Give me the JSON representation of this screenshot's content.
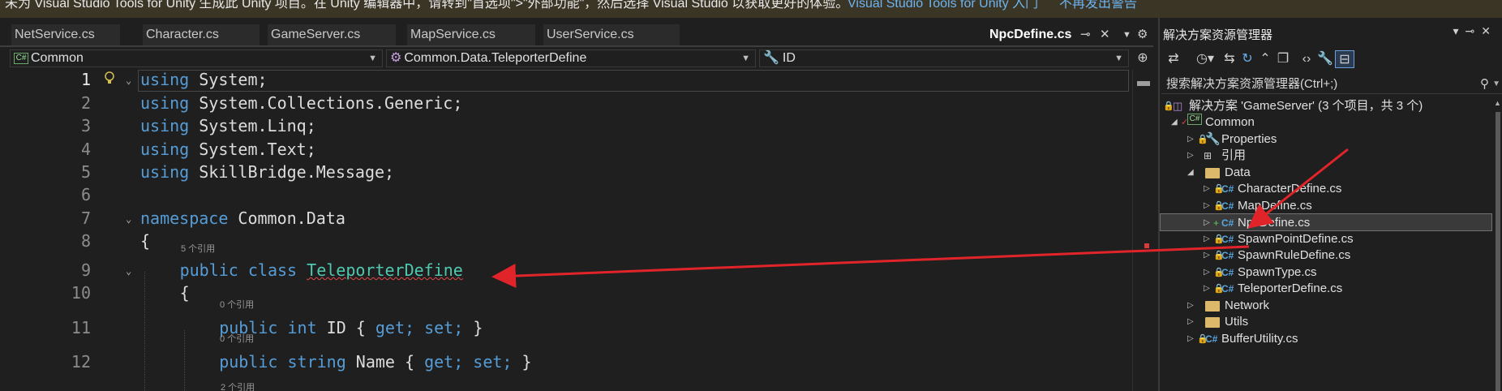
{
  "infobar": {
    "message": "未为 Visual Studio Tools for Unity 生成此 Unity 项目。在 Unity 编辑器中，请转到\"首选项\">\"外部功能\"，然后选择 Visual Studio 以获取更好的体验。",
    "link_tools": "Visual Studio Tools for Unity 入门",
    "link_dismiss": "不再发出警告"
  },
  "tabs": [
    "NetService.cs",
    "Character.cs",
    "GameServer.cs",
    "MapService.cs",
    "UserService.cs"
  ],
  "active_tab": "NpcDefine.cs",
  "tab_icons": {
    "pin": "pin-icon",
    "close": "close-icon",
    "menu": "chevron-down-icon",
    "settings": "gear-icon"
  },
  "navbar": {
    "project": "Common",
    "type": "Common.Data.TeleporterDefine",
    "member": "ID"
  },
  "editor": {
    "lines": [
      {
        "n": "1",
        "ref": "",
        "tokens": [
          [
            "kw",
            "using"
          ],
          [
            "",
            "System;"
          ]
        ]
      },
      {
        "n": "2",
        "ref": "",
        "tokens": [
          [
            "kw",
            "using"
          ],
          [
            "",
            "System.Collections.Generic;"
          ]
        ]
      },
      {
        "n": "3",
        "ref": "",
        "tokens": [
          [
            "kw",
            "using"
          ],
          [
            "",
            "System.Linq;"
          ]
        ]
      },
      {
        "n": "4",
        "ref": "",
        "tokens": [
          [
            "kw",
            "using"
          ],
          [
            "",
            "System.Text;"
          ]
        ]
      },
      {
        "n": "5",
        "ref": "",
        "tokens": [
          [
            "kw",
            "using"
          ],
          [
            "",
            "SkillBridge.Message;"
          ]
        ]
      },
      {
        "n": "6",
        "ref": "",
        "tokens": []
      },
      {
        "n": "7",
        "ref": "",
        "tokens": [
          [
            "kw",
            "namespace"
          ],
          [
            "",
            "Common.Data"
          ]
        ]
      },
      {
        "n": "8",
        "ref": "",
        "tokens": [
          [
            "",
            "{"
          ]
        ]
      },
      {
        "n": "9",
        "ref": "5 个引用",
        "tokens": [
          [
            "kw",
            "public"
          ],
          [
            "kw",
            "class"
          ],
          [
            "ty squig",
            "TeleporterDefine"
          ]
        ]
      },
      {
        "n": "10",
        "ref": "",
        "tokens": [
          [
            "",
            "{"
          ]
        ]
      },
      {
        "n": "11",
        "ref": "0 个引用",
        "tokens": [
          [
            "kw",
            "public"
          ],
          [
            "kw",
            "int"
          ],
          [
            "",
            "ID {"
          ],
          [
            "kw",
            "get;"
          ],
          [
            "kw",
            "set;"
          ],
          [
            "",
            "}"
          ]
        ]
      },
      {
        "n": "12",
        "ref": "0 个引用",
        "tokens": [
          [
            "kw",
            "public"
          ],
          [
            "kw",
            "string"
          ],
          [
            "",
            "Name {"
          ],
          [
            "kw",
            "get;"
          ],
          [
            "kw",
            "set;"
          ],
          [
            "",
            "}"
          ]
        ]
      }
    ],
    "trailing_ref": "2 个引用"
  },
  "solution_explorer": {
    "title": "解决方案资源管理器",
    "search_placeholder": "搜索解决方案资源管理器(Ctrl+;)",
    "solution_label": "解决方案 'GameServer' (3 个项目，共 3 个)",
    "nodes": [
      {
        "label": "Common",
        "kind": "project"
      },
      {
        "label": "Properties",
        "kind": "properties"
      },
      {
        "label": "引用",
        "kind": "references"
      },
      {
        "label": "Data",
        "kind": "folder"
      },
      {
        "label": "CharacterDefine.cs",
        "kind": "cs"
      },
      {
        "label": "MapDefine.cs",
        "kind": "cs"
      },
      {
        "label": "NpcDefine.cs",
        "kind": "cs-new"
      },
      {
        "label": "SpawnPointDefine.cs",
        "kind": "cs"
      },
      {
        "label": "SpawnRuleDefine.cs",
        "kind": "cs"
      },
      {
        "label": "SpawnType.cs",
        "kind": "cs"
      },
      {
        "label": "TeleporterDefine.cs",
        "kind": "cs"
      },
      {
        "label": "Network",
        "kind": "folder"
      },
      {
        "label": "Utils",
        "kind": "folder"
      },
      {
        "label": "BufferUtility.cs",
        "kind": "cs"
      }
    ]
  },
  "colors": {
    "keyword": "#569cd6",
    "type": "#4ec9b0",
    "annotation_arrow": "#e0242a",
    "infobar_bg": "#3b3526",
    "link": "#6cb4f2"
  }
}
